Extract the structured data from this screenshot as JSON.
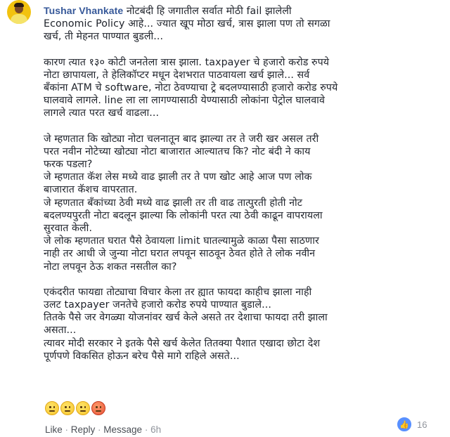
{
  "comment": {
    "author": "Tushar Vhankate",
    "paragraphs": [
      [
        "नोटबंदी हि जगातील सर्वात मोठी fail झालेली",
        "Economic Policy आहे... ज्यात खूप मोठा खर्च, त्रास झाला पण तो सगळा",
        "खर्च, ती मेहनत पाण्यात बुडली..."
      ],
      [
        "कारण त्यात १३० कोटी जनतेला त्रास झाला. taxpayer चे हजारो करोड रुपये",
        "नोटा छापायला, ते हेलिकॉप्टर मधून देशभरात पाठवायला खर्च झाले... सर्व",
        "बँकांना ATM चे software, नोटा ठेवण्याचा ट्रे बदलण्यासाठी हजारो करोड रुपये",
        "घालवावे लागले. line ला ला लागण्यासाठी येण्यासाठी लोकांना पेट्रोल घालवावे",
        "लागले त्यात परत खर्च वाढला..."
      ],
      [
        "जे म्हणतात कि खोट्या नोटा चलनातून बाद झाल्या तर ते जरी खर असल तरी",
        "परत नवीन नोटेच्या खोट्या नोटा बाजारात आल्यातच कि? नोट बंदी ने काय",
        "फरक पडला?",
        "जे म्हणतात कॅश लेस मध्ये वाढ झाली तर ते पण खोट आहे आज पण लोक",
        "बाजारात कॅशच वापरतात.",
        "जे म्हणतात बँकांच्या ठेवी मध्ये वाढ झाली तर ती वाढ तात्पुरती होती नोट",
        "बदलण्यपुरती नोटा बदलून झाल्या कि लोकांनी परत त्या ठेवी काढून वापरायला",
        "सुरवात केली.",
        "जे लोक म्हणतात घरात पैसे ठेवायला limit घातल्यामुळे काळा पैसा साठणार",
        "नाही तर आधी जे जुन्या नोटा घरात लपवून साठवून ठेवत होते ते लोक नवीन",
        "नोटा लपवून ठेऊ शकत नसतील का?"
      ],
      [
        "एकंदरीत फायद्या तोट्याचा विचार केला तर ह्यात फायदा काहीच झाला नाही",
        "उलट taxpayer जनतेचे हजारो करोड रुपये पाण्यात बुडाले...",
        "तितके पैसे जर वेगळ्या योजनांवर खर्च केले असते तर देशाचा फायदा तरी झाला",
        "असता...",
        "त्यावर मोदी सरकार ने इतके पैसे खर्च केलेत तितक्या पैशात एखादा छोटा देश",
        "पूर्णपणे विकसित होऊन बरेच पैसे मागे राहिले असते..."
      ]
    ],
    "emojis": [
      "neutral-face",
      "neutral-face",
      "neutral-face",
      "angry-face"
    ],
    "actions": {
      "like": "Like",
      "sep1": " · ",
      "reply": "Reply",
      "sep2": " · ",
      "message": "Message",
      "sep3": " · ",
      "time": "6h"
    },
    "reaction_count": "16",
    "colors": {
      "author": "#365899",
      "like_badge": "#5890ff",
      "meta": "#90949c"
    }
  }
}
